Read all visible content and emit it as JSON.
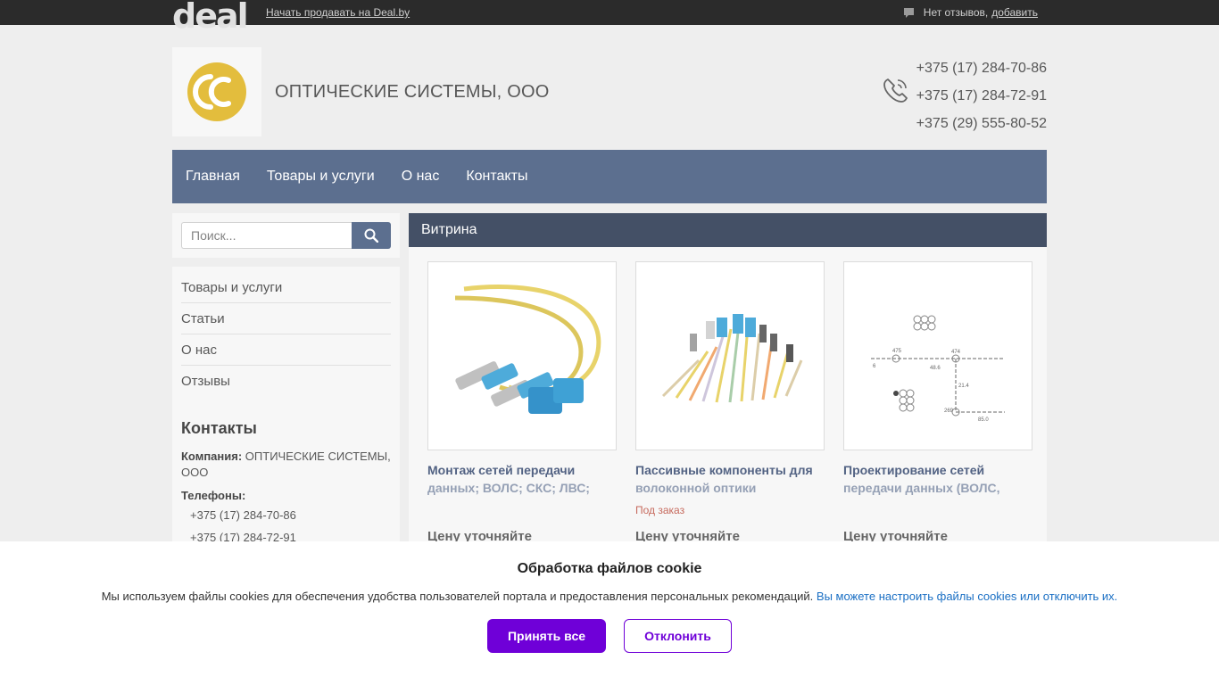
{
  "topbar": {
    "logo": "deal",
    "sell_link": "Начать продавать на Deal.by",
    "reviews_text": "Нет отзывов,",
    "reviews_add": "добавить"
  },
  "header": {
    "company_name": "ОПТИЧЕСКИЕ СИСТЕМЫ, ООО",
    "phones": [
      "+375 (17) 284-70-86",
      "+375 (17) 284-72-91",
      "+375 (29) 555-80-52"
    ]
  },
  "nav": {
    "items": [
      "Главная",
      "Товары и услуги",
      "О нас",
      "Контакты"
    ]
  },
  "search": {
    "placeholder": "Поиск..."
  },
  "sidebar": {
    "menu": [
      "Товары и услуги",
      "Статьи",
      "О нас",
      "Отзывы"
    ],
    "contacts_title": "Контакты",
    "company_label": "Компания:",
    "company_value": "ОПТИЧЕСКИЕ СИСТЕМЫ, ООО",
    "phones_label": "Телефоны:",
    "phones": [
      "+375 (17) 284-70-86",
      "+375 (17) 284-72-91"
    ]
  },
  "main": {
    "heading": "Витрина",
    "cards": [
      {
        "title_a": "Монтаж сетей передачи",
        "title_b": "данных; ВОЛС; СКС; ЛВС;",
        "availability": "",
        "price": "Цену уточняйте"
      },
      {
        "title_a": "Пассивные компоненты для",
        "title_b": "волоконной оптики",
        "availability": "Под заказ",
        "price": "Цену уточняйте"
      },
      {
        "title_a": "Проектирование сетей",
        "title_b": "передачи данных (ВОЛС,",
        "availability": "",
        "price": "Цену уточняйте"
      }
    ],
    "drawing_labels": [
      "475",
      "474",
      "6",
      "48.6",
      "21.4",
      "269",
      "85.0"
    ]
  },
  "cookie": {
    "title": "Обработка файлов cookie",
    "text": "Мы используем файлы cookies для обеспечения удобства пользователей портала и предоставления персональных рекомендаций.",
    "link": "Вы можете настроить файлы cookies или отключить их.",
    "accept": "Принять все",
    "decline": "Отклонить"
  },
  "colors": {
    "nav_bg": "#4a5f83",
    "vitrina_bg": "#2f3d55",
    "accent": "#6f00d8",
    "logo_yellow": "#e0b628"
  }
}
